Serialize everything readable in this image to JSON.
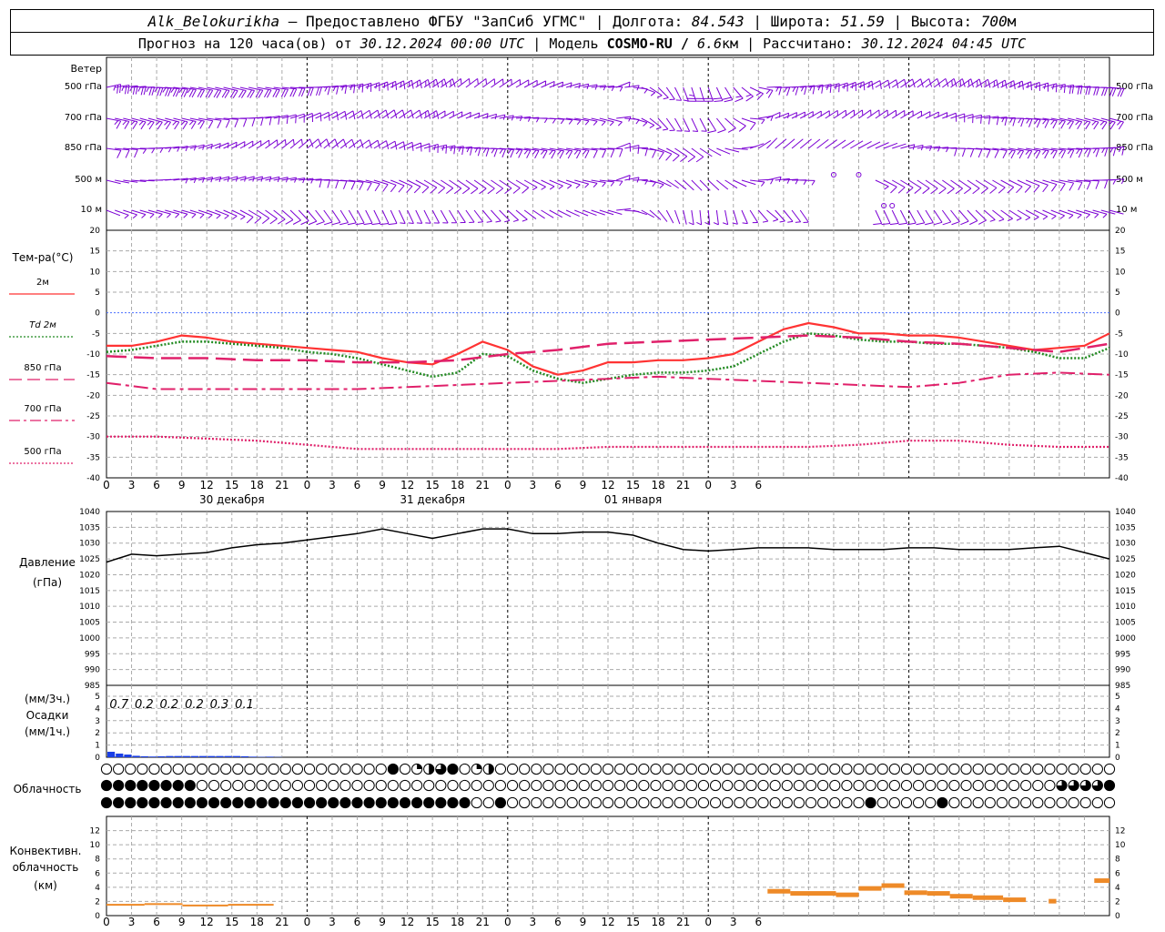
{
  "header": {
    "station": "Alk_Belokurikha",
    "provider": " – Предоставлено ФГБУ \"ЗапСиб УГМС\" | Долгота: ",
    "lon": "84.543",
    "lat_label": " | Широта: ",
    "lat": "51.59",
    "alt_label": " | Высота: ",
    "alt": "700",
    "alt_unit": "м",
    "forecast_label": "Прогноз на 120 часа(ов) от ",
    "forecast_time": "30.12.2024 00:00 UTC",
    "model_label": " | Модель ",
    "model": "COSMO-RU / ",
    "resolution": "6.6",
    "res_unit": "км",
    "calc_label": " | Рассчитано: ",
    "calc_time": "30.12.2024 04:45 UTC"
  },
  "labels": {
    "wind_title": "Ветер",
    "wind_levels": [
      "500 гПа",
      "700 гПа",
      "850 гПа",
      "500  м",
      "10   м"
    ],
    "temp_title": "Тем-ра(°С)",
    "temp_legend": [
      {
        "text": "2м",
        "color": "#ff3333",
        "dash": "solid"
      },
      {
        "text": "Td  2м",
        "color": "#228b22",
        "dash": "dot"
      },
      {
        "text": "850 гПа",
        "color": "#e0206a",
        "dash": "long"
      },
      {
        "text": "700 гПа",
        "color": "#e0206a",
        "dash": "dashdot"
      },
      {
        "text": "500 гПа",
        "color": "#e0206a",
        "dash": "dot"
      }
    ],
    "pressure_title": "Давление",
    "pressure_unit": "(гПа)",
    "precip_unit3": "(мм/3ч.)",
    "precip_title": "Осадки",
    "precip_unit1": "(мм/1ч.)",
    "cloud_title": "Облачность",
    "conv_title1": "Конвективн.",
    "conv_title2": "облачность",
    "conv_unit": "(км)"
  },
  "colors": {
    "wind": "#7b00d4",
    "grid": "#aaaaaa",
    "pressure": "#000000",
    "precip": "#1a3fe6",
    "conv": "#ee8a28"
  },
  "chart_data": [
    {
      "type": "barbs",
      "title": "Ветер",
      "levels": [
        "500 гПа",
        "700 гПа",
        "850 гПа",
        "500  м",
        "10   м"
      ],
      "x_hours": [
        0,
        120
      ],
      "note_symbols": "calm circles near hour 84–91"
    },
    {
      "type": "line",
      "ylabel": "Тем-ра(°С)",
      "ylim": [
        -40,
        20
      ],
      "yticks": [
        20,
        15,
        10,
        5,
        0,
        -5,
        -10,
        -15,
        -20,
        -25,
        -30,
        -35,
        -40
      ],
      "series": [
        {
          "name": "2м",
          "x": [
            0,
            3,
            6,
            9,
            12,
            15,
            18,
            21,
            24,
            27,
            30,
            33,
            36,
            39,
            42,
            45,
            48,
            51,
            54,
            57,
            60,
            63,
            66,
            69,
            72,
            75,
            78,
            81,
            84,
            87,
            90,
            93,
            96,
            99,
            102,
            105,
            108,
            111,
            114,
            117,
            120
          ],
          "values": [
            -8,
            -8,
            -7,
            -5.5,
            -6,
            -7,
            -7.5,
            -8,
            -8.5,
            -9,
            -9.5,
            -11,
            -12,
            -12.5,
            -10,
            -7,
            -9,
            -13,
            -15,
            -14,
            -12,
            -12,
            -11.5,
            -11.5,
            -11,
            -10,
            -7,
            -4,
            -2.5,
            -3.5,
            -5,
            -5,
            -5.5,
            -5.5,
            -6,
            -7,
            -8,
            -9,
            -8.5,
            -8,
            -5
          ]
        },
        {
          "name": "Td  2м",
          "x": [
            0,
            3,
            6,
            9,
            12,
            15,
            18,
            21,
            24,
            27,
            30,
            33,
            36,
            39,
            42,
            45,
            48,
            51,
            54,
            57,
            60,
            63,
            66,
            69,
            72,
            75,
            78,
            81,
            84,
            87,
            90,
            93,
            96,
            99,
            102,
            105,
            108,
            111,
            114,
            117,
            120
          ],
          "values": [
            -9.5,
            -9,
            -8,
            -7,
            -7,
            -7.5,
            -8,
            -8.5,
            -9.5,
            -10,
            -11,
            -12.5,
            -14,
            -15.5,
            -14.5,
            -10,
            -10.5,
            -14,
            -16,
            -17,
            -16,
            -15,
            -14.5,
            -14.5,
            -14,
            -13,
            -10,
            -7,
            -5,
            -5.5,
            -6.5,
            -7,
            -7,
            -7.5,
            -7.5,
            -8,
            -8.5,
            -9.5,
            -11,
            -11,
            -8.5
          ]
        },
        {
          "name": "850 гПа",
          "x": [
            0,
            6,
            12,
            18,
            24,
            30,
            36,
            42,
            48,
            54,
            60,
            66,
            72,
            78,
            84,
            90,
            96,
            102,
            108,
            114,
            120
          ],
          "values": [
            -10.5,
            -11,
            -11,
            -11.5,
            -11.5,
            -12,
            -12,
            -11.5,
            -10,
            -9,
            -7.5,
            -7,
            -6.5,
            -6,
            -5.5,
            -6,
            -7,
            -7.5,
            -8.5,
            -9.5,
            -7.5
          ]
        },
        {
          "name": "700 гПа",
          "x": [
            0,
            6,
            12,
            18,
            24,
            30,
            36,
            42,
            48,
            54,
            60,
            66,
            72,
            78,
            84,
            90,
            96,
            102,
            108,
            114,
            120
          ],
          "values": [
            -17,
            -18.5,
            -18.5,
            -18.5,
            -18.5,
            -18.5,
            -18,
            -17.5,
            -17,
            -16.5,
            -16,
            -15.5,
            -16,
            -16.5,
            -17,
            -17.5,
            -18,
            -17,
            -15,
            -14.5,
            -15
          ]
        },
        {
          "name": "500 гПа",
          "x": [
            0,
            6,
            12,
            18,
            24,
            30,
            36,
            42,
            48,
            54,
            60,
            66,
            72,
            78,
            84,
            90,
            96,
            102,
            108,
            114,
            120
          ],
          "values": [
            -30,
            -30,
            -30.5,
            -31,
            -32,
            -33,
            -33,
            -33,
            -33,
            -33,
            -32.5,
            -32.5,
            -32.5,
            -32.5,
            -32.5,
            -32,
            -31,
            -31,
            -32,
            -32.5,
            -32.5
          ]
        }
      ]
    },
    {
      "type": "line",
      "ylabel": "Давление (гПа)",
      "ylim": [
        985,
        1040
      ],
      "yticks": [
        1040,
        1035,
        1030,
        1025,
        1020,
        1015,
        1010,
        1005,
        1000,
        995,
        990,
        985
      ],
      "series": [
        {
          "name": "Давление",
          "x": [
            0,
            3,
            6,
            9,
            12,
            15,
            18,
            21,
            24,
            27,
            30,
            33,
            36,
            39,
            42,
            45,
            48,
            51,
            54,
            57,
            60,
            63,
            66,
            69,
            72,
            75,
            78,
            81,
            84,
            87,
            90,
            93,
            96,
            99,
            102,
            105,
            108,
            111,
            114,
            117,
            120
          ],
          "values": [
            1024,
            1026.5,
            1026,
            1026.5,
            1027,
            1028.5,
            1029.5,
            1030,
            1031,
            1032,
            1033,
            1034.5,
            1033,
            1031.5,
            1033,
            1034.5,
            1034.5,
            1033,
            1033,
            1033.5,
            1033.5,
            1032.5,
            1030,
            1028,
            1027.5,
            1028,
            1028.5,
            1028.5,
            1028.5,
            1028,
            1028,
            1028,
            1028.5,
            1028.5,
            1028,
            1028,
            1028,
            1028.5,
            1029,
            1027,
            1025
          ]
        }
      ]
    },
    {
      "type": "bar",
      "ylabel": "Осадки (мм/1ч.)",
      "ylim": [
        0,
        5
      ],
      "yticks": [
        5,
        4,
        3,
        2,
        1,
        0
      ],
      "labels_3h": [
        "0.7",
        "0.2",
        "0.2",
        "0.2",
        "0.3",
        "0.1"
      ],
      "x": [
        1,
        2,
        3,
        4,
        5,
        6,
        7,
        8,
        9,
        10,
        11,
        12,
        13,
        14,
        15,
        16,
        17,
        18,
        19,
        20,
        21
      ],
      "values": [
        0.45,
        0.3,
        0.22,
        0.12,
        0.08,
        0.06,
        0.08,
        0.1,
        0.1,
        0.1,
        0.1,
        0.1,
        0.1,
        0.1,
        0.1,
        0.1,
        0.08,
        0.05,
        0.03,
        0.05,
        0.02
      ]
    },
    {
      "type": "table",
      "title": "Облачность",
      "rows": 3,
      "columns_hourly": 120
    },
    {
      "type": "bar",
      "ylabel": "Конвективн. облачность (км)",
      "ylim": [
        0,
        14
      ],
      "yticks": [
        12,
        10,
        8,
        6,
        4,
        2,
        0
      ],
      "segments": [
        {
          "x0": 0,
          "x1": 5,
          "y": 1.4
        },
        {
          "x0": 5,
          "x1": 10,
          "y": 1.5
        },
        {
          "x0": 10,
          "x1": 16,
          "y": 1.3
        },
        {
          "x0": 16,
          "x1": 22,
          "y": 1.4
        },
        {
          "x0": 87,
          "x1": 90,
          "y": 3.5
        },
        {
          "x0": 90,
          "x1": 96,
          "y": 3.2
        },
        {
          "x0": 96,
          "x1": 99,
          "y": 3.0
        },
        {
          "x0": 99,
          "x1": 102,
          "y": 3.9
        },
        {
          "x0": 102,
          "x1": 105,
          "y": 4.3
        },
        {
          "x0": 105,
          "x1": 108,
          "y": 3.3
        },
        {
          "x0": 108,
          "x1": 111,
          "y": 3.2
        },
        {
          "x0": 111,
          "x1": 114,
          "y": 2.8
        },
        {
          "x0": 114,
          "x1": 118,
          "y": 2.6
        },
        {
          "x0": 118,
          "x1": 121,
          "y": 2.3
        },
        {
          "x0": 124,
          "x1": 125,
          "y": 2.1
        },
        {
          "x0": 130,
          "x1": 132,
          "y": 5.0
        }
      ]
    }
  ],
  "axis": {
    "hour_labels": [
      "0",
      "3",
      "6",
      "9",
      "12",
      "15",
      "18",
      "21",
      "0",
      "3",
      "6",
      "9",
      "12",
      "15",
      "18",
      "21",
      "0",
      "3",
      "6",
      "9",
      "12",
      "15",
      "18",
      "21",
      "0",
      "3",
      "6"
    ],
    "dates": [
      "30 декабря",
      "31 декабря",
      "01 января"
    ]
  }
}
